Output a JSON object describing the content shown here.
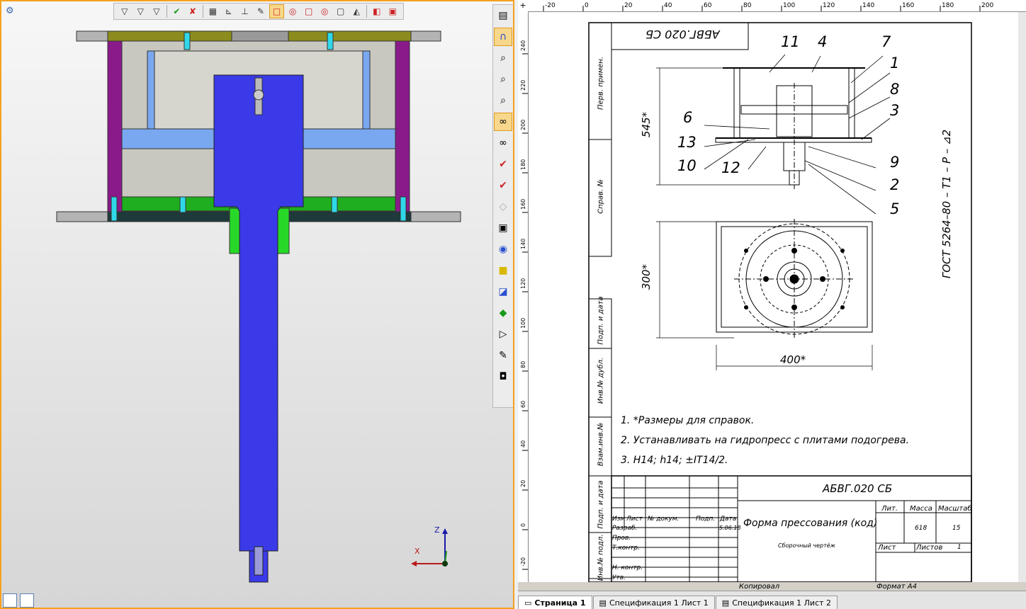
{
  "rulers": {
    "top_ticks": [
      "-20",
      "0",
      "20",
      "40",
      "60",
      "80",
      "100",
      "120",
      "140",
      "160",
      "180",
      "200"
    ],
    "left_ticks": [
      "240",
      "220",
      "200",
      "180",
      "160",
      "140",
      "120",
      "100",
      "80",
      "60",
      "40",
      "20",
      "0",
      "-20"
    ]
  },
  "axes": {
    "z": "Z",
    "x": "X"
  },
  "drawing": {
    "designation_mirrored": "АБВГ.020 СБ",
    "side_labels": [
      "Перв. примен.",
      "Справ. №",
      "Подп. и дата",
      "Инв.№ дубл.",
      "Взам.инв.№",
      "Подп. и дата",
      "Инв.№ подл."
    ],
    "dim_height": "545*",
    "dim_width_top": "300*",
    "dim_width_bottom": "400*",
    "callouts": [
      "11",
      "4",
      "7",
      "1",
      "8",
      "3",
      "6",
      "13",
      "10",
      "12",
      "9",
      "2",
      "5"
    ],
    "gost": "ГОСТ 5264–80 – Т1 – Р – ⊿2",
    "notes": [
      "1. *Размеры для справок.",
      "2. Устанавливать на гидропресс с плитами подогрева.",
      "3. H14; h14; ±IT14/2."
    ]
  },
  "title_block": {
    "designation": "АБВГ.020 СБ",
    "name": "Форма прессования (код)",
    "doc_type": "Сборочный чертёж",
    "col_izm": "Изм",
    "col_list": "Лист",
    "col_doc": "№ докум.",
    "col_sign": "Подп.",
    "col_date": "Дата",
    "date_value": "5.06.18",
    "row_razrab": "Разраб.",
    "row_prov": "Пров.",
    "row_tkontr": "Т.контр.",
    "row_nkontr": "Н. контр.",
    "row_utv": "Утв.",
    "lit": "Лит.",
    "massa": "Масса",
    "masshtab": "Масштаб",
    "massa_value": "618",
    "masshtab_value": "15",
    "list_label": "Лист",
    "listov_label": "Листов",
    "listov_value": "1",
    "kopiroval": "Копировал",
    "format": "Формат  А4"
  },
  "tabs": [
    {
      "label": "Страница 1",
      "active": true
    },
    {
      "label": "Спецификация 1 Лист 1",
      "active": false
    },
    {
      "label": "Спецификация 1 Лист 2",
      "active": false
    }
  ],
  "colors": {
    "accent": "#f5a020",
    "shaft": "#3a3ae8",
    "frame": "#8a1a8a",
    "plate_top": "#8c8c1e",
    "plate_green": "#1fae1f",
    "blue_light": "#7aa8f0"
  }
}
